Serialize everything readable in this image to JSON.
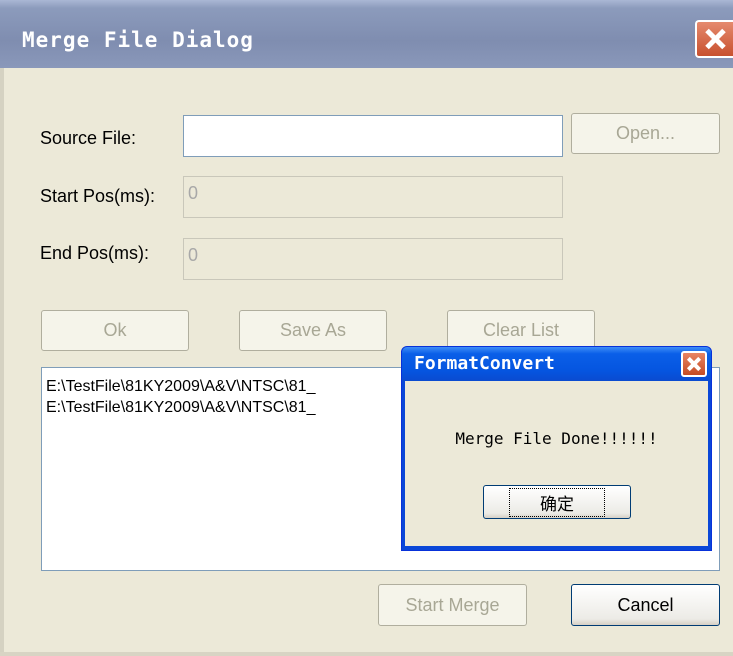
{
  "dialog": {
    "title": "Merge File Dialog",
    "source_label": "Source File:",
    "source_value": "",
    "open_button": "Open...",
    "start_label": "Start Pos(ms):",
    "start_value": "0",
    "end_label": "End Pos(ms):",
    "end_value": "0",
    "ok_button": "Ok",
    "save_as_button": "Save As",
    "clear_list_button": "Clear List",
    "files": [
      "E:\\TestFile\\81KY2009\\A&V\\NTSC\\81_",
      "E:\\TestFile\\81KY2009\\A&V\\NTSC\\81_"
    ],
    "start_merge_button": "Start Merge",
    "cancel_button": "Cancel"
  },
  "message_box": {
    "title": "FormatConvert",
    "message": "Merge File Done!!!!!!",
    "ok_button": "确定"
  },
  "colors": {
    "face": "#ECE9D8",
    "title_inactive": "#7f8db0",
    "title_active": "#0555e0",
    "close": "#c8512f"
  }
}
